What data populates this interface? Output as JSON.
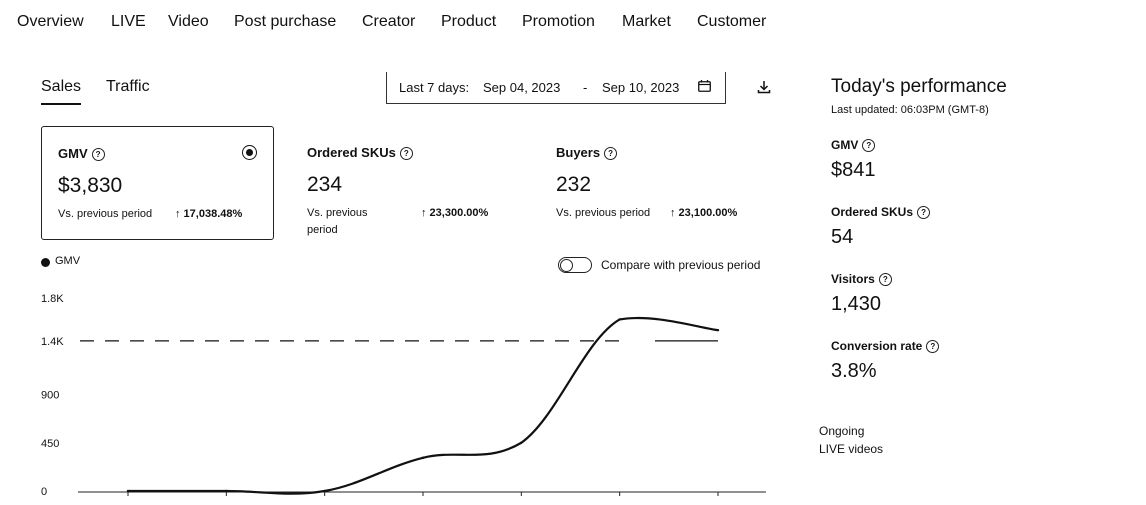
{
  "nav": {
    "items": [
      "Overview",
      "LIVE",
      "Video",
      "Post purchase",
      "Creator",
      "Product",
      "Promotion",
      "Market",
      "Customer"
    ]
  },
  "tabs": {
    "sales": "Sales",
    "traffic": "Traffic"
  },
  "date_range": {
    "prefix": "Last 7 days:",
    "start": "Sep 04, 2023",
    "separator": "-",
    "end": "Sep 10, 2023"
  },
  "metrics": {
    "gmv": {
      "title": "GMV",
      "value": "$3,830",
      "compare_label": "Vs. previous period",
      "delta": "↑ 17,038.48%"
    },
    "ordered_skus": {
      "title": "Ordered SKUs",
      "value": "234",
      "compare_label": "Vs. previous period",
      "delta": "↑ 23,300.00%"
    },
    "buyers": {
      "title": "Buyers",
      "value": "232",
      "compare_label": "Vs. previous period",
      "delta": "↑ 23,100.00%"
    }
  },
  "chart": {
    "legend": "GMV",
    "compare_toggle_label": "Compare with previous period"
  },
  "chart_data": {
    "type": "line",
    "series": [
      {
        "name": "GMV",
        "x": [
          0,
          1,
          2,
          3,
          4,
          5,
          6
        ],
        "values": [
          0,
          0,
          0,
          310,
          450,
          1600,
          1500
        ]
      }
    ],
    "reference_line": 1400,
    "ylim": [
      0,
      1800
    ],
    "yticks": [
      "0",
      "450",
      "900",
      "1.4K",
      "1.8K"
    ],
    "ytick_values": [
      0,
      450,
      900,
      1400,
      1800
    ]
  },
  "today": {
    "title": "Today's performance",
    "updated": "Last updated: 06:03PM (GMT-8)",
    "gmv_label": "GMV",
    "gmv_value": "$841",
    "skus_label": "Ordered SKUs",
    "skus_value": "54",
    "visitors_label": "Visitors",
    "visitors_value": "1,430",
    "conversion_label": "Conversion rate",
    "conversion_value": "3.8%",
    "ongoing_line1": "Ongoing",
    "ongoing_line2": "LIVE videos"
  },
  "icons": {
    "help": "?",
    "calendar": "calendar-icon",
    "download": "download-icon"
  }
}
